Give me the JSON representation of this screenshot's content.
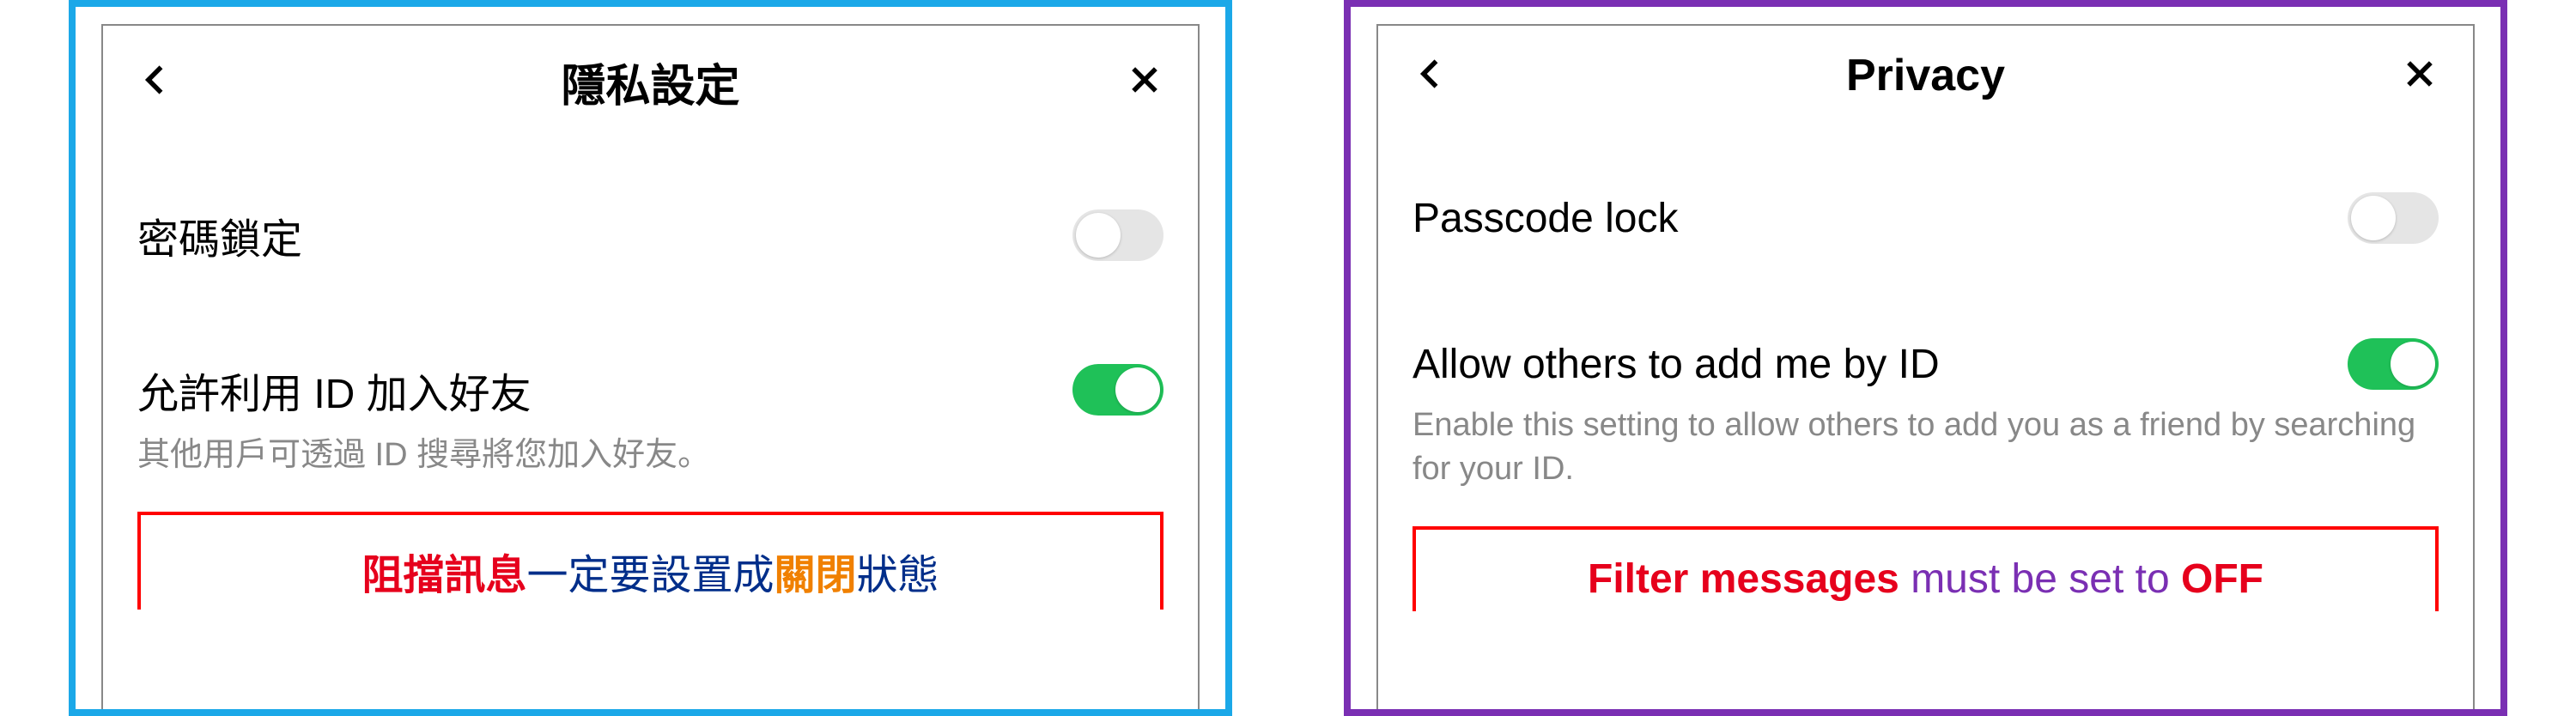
{
  "left": {
    "title": "隱私設定",
    "passcode_label": "密碼鎖定",
    "allow_id_label": "允許利用 ID 加入好友",
    "allow_id_desc": "其他用戶可透過 ID 搜尋將您加入好友。",
    "annotation": {
      "p1": "阻擋訊息",
      "p2": "一定要設置成",
      "p3": "關閉",
      "p4": "狀態"
    }
  },
  "right": {
    "title": "Privacy",
    "passcode_label": "Passcode lock",
    "allow_id_label": "Allow others to add me by ID",
    "allow_id_desc": "Enable this setting to allow others to add you as a friend by searching for your ID.",
    "annotation": {
      "p1": "Filter messages",
      "p2": " must be set to ",
      "p3": "OFF"
    }
  }
}
